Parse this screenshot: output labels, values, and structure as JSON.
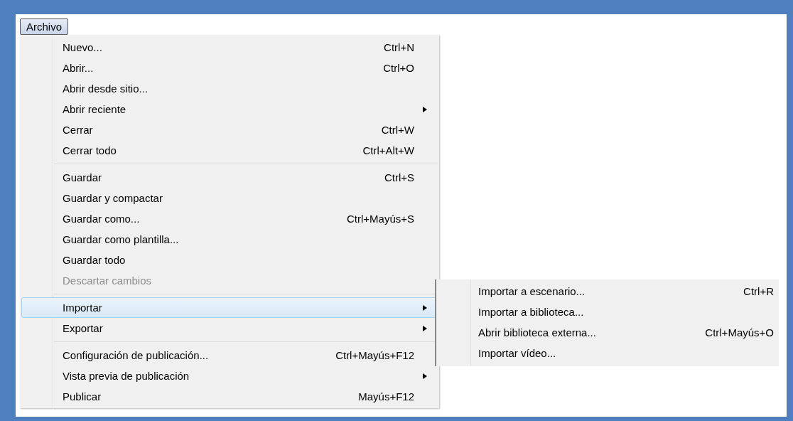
{
  "menu_bar": [
    {
      "label": "Archivo",
      "selected": true
    }
  ],
  "menu": [
    {
      "kind": "item",
      "label": "Nuevo...",
      "shortcut": "Ctrl+N",
      "submenu": false,
      "disabled": false,
      "selected": false
    },
    {
      "kind": "item",
      "label": "Abrir...",
      "shortcut": "Ctrl+O",
      "submenu": false,
      "disabled": false,
      "selected": false
    },
    {
      "kind": "item",
      "label": "Abrir desde sitio...",
      "submenu": false,
      "disabled": false,
      "selected": false
    },
    {
      "kind": "item",
      "label": "Abrir reciente",
      "submenu": true,
      "disabled": false,
      "selected": false
    },
    {
      "kind": "item",
      "label": "Cerrar",
      "shortcut": "Ctrl+W",
      "submenu": false,
      "disabled": false,
      "selected": false
    },
    {
      "kind": "item",
      "label": "Cerrar todo",
      "shortcut": "Ctrl+Alt+W",
      "submenu": false,
      "disabled": false,
      "selected": false
    },
    {
      "kind": "separator"
    },
    {
      "kind": "item",
      "label": "Guardar",
      "shortcut": "Ctrl+S",
      "submenu": false,
      "disabled": false,
      "selected": false
    },
    {
      "kind": "item",
      "label": "Guardar y compactar",
      "submenu": false,
      "disabled": false,
      "selected": false
    },
    {
      "kind": "item",
      "label": "Guardar como...",
      "shortcut": "Ctrl+Mayús+S",
      "submenu": false,
      "disabled": false,
      "selected": false
    },
    {
      "kind": "item",
      "label": "Guardar como plantilla...",
      "submenu": false,
      "disabled": false,
      "selected": false
    },
    {
      "kind": "item",
      "label": "Guardar todo",
      "submenu": false,
      "disabled": false,
      "selected": false
    },
    {
      "kind": "item",
      "label": "Descartar cambios",
      "submenu": false,
      "disabled": true,
      "selected": false
    },
    {
      "kind": "separator"
    },
    {
      "kind": "item",
      "label": "Importar",
      "submenu": true,
      "disabled": false,
      "selected": true
    },
    {
      "kind": "item",
      "label": "Exportar",
      "submenu": true,
      "disabled": false,
      "selected": false
    },
    {
      "kind": "separator"
    },
    {
      "kind": "item",
      "label": "Configuración de publicación...",
      "shortcut": "Ctrl+Mayús+F12",
      "submenu": false,
      "disabled": false,
      "selected": false
    },
    {
      "kind": "item",
      "label": "Vista previa de publicación",
      "submenu": true,
      "disabled": false,
      "selected": false
    },
    {
      "kind": "item",
      "label": "Publicar",
      "shortcut": "Mayús+F12",
      "submenu": false,
      "disabled": false,
      "selected": false
    }
  ],
  "submenu": [
    {
      "label": "Importar a escenario...",
      "shortcut": "Ctrl+R"
    },
    {
      "label": "Importar a biblioteca..."
    },
    {
      "label": "Abrir biblioteca externa...",
      "shortcut": "Ctrl+Mayús+O"
    },
    {
      "label": "Importar vídeo..."
    }
  ]
}
